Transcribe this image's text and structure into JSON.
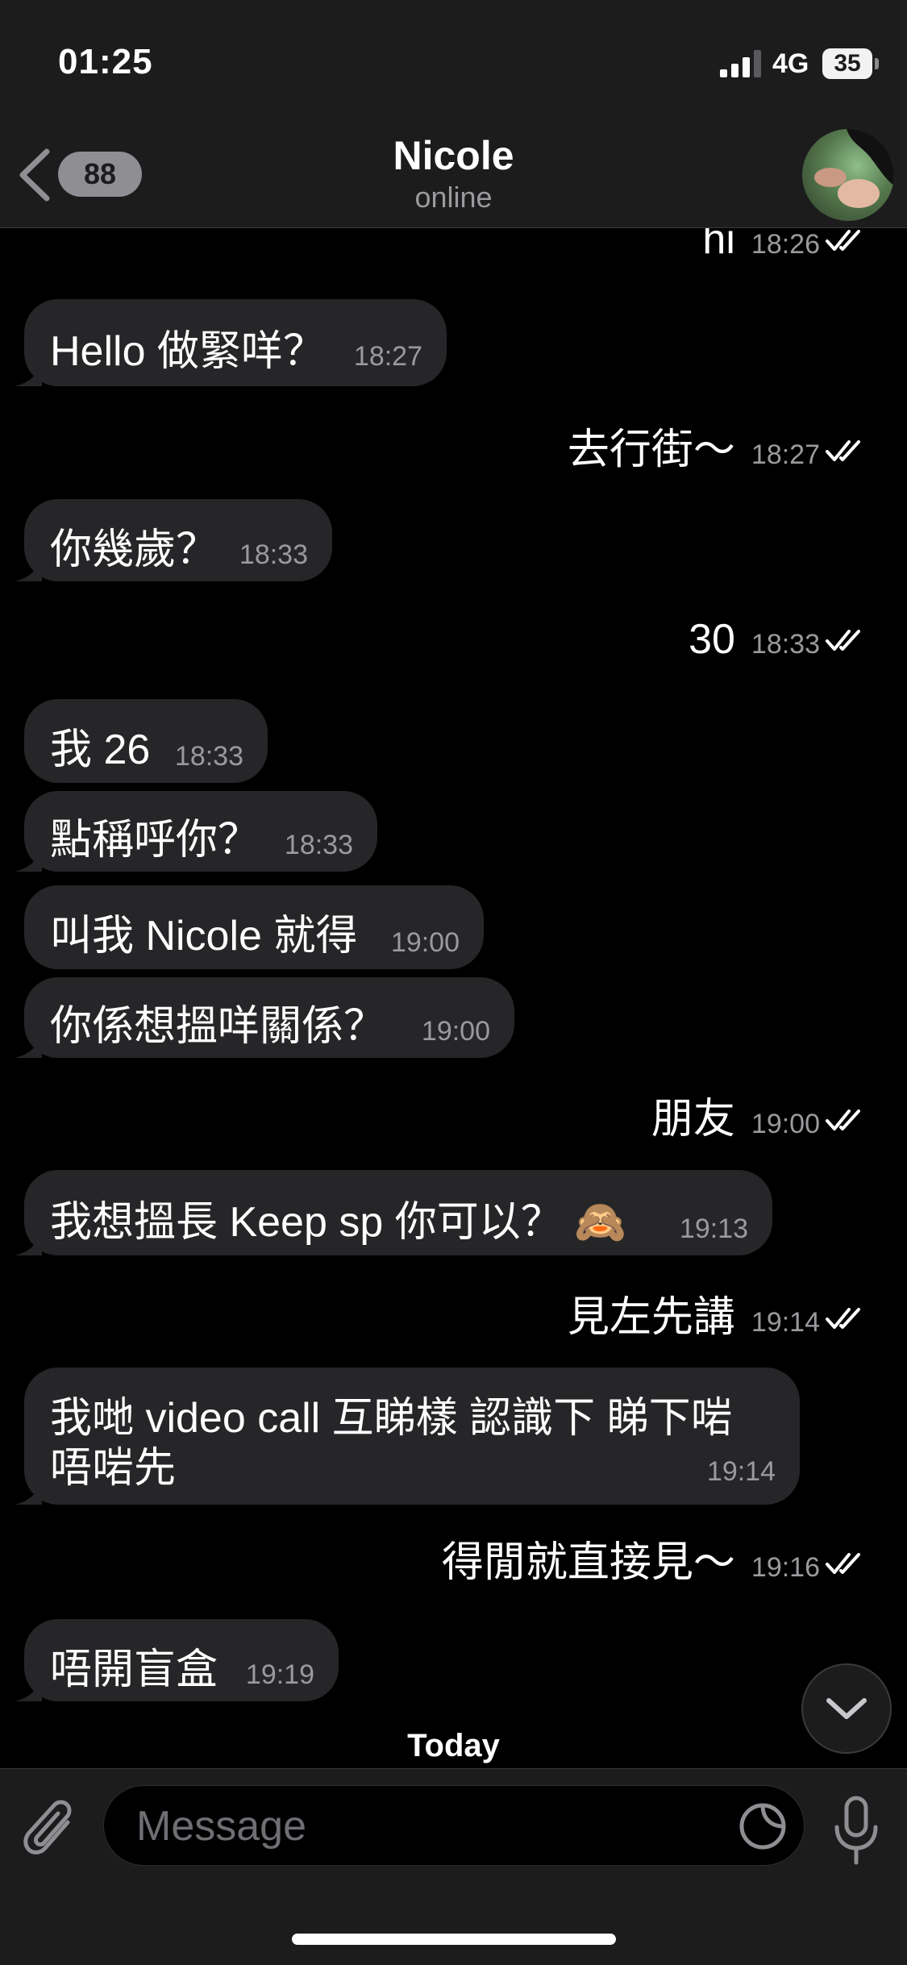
{
  "status_bar": {
    "time": "01:25",
    "network": "4G",
    "battery": "35"
  },
  "header": {
    "back_count": "88",
    "name": "Nicole",
    "status": "online"
  },
  "messages": [
    {
      "dir": "out",
      "text": "hi",
      "time": "18:26"
    },
    {
      "dir": "in",
      "text": "Hello 做緊咩？",
      "time": "18:27"
    },
    {
      "dir": "out",
      "text": "去行街～",
      "time": "18:27"
    },
    {
      "dir": "in",
      "text": "你幾歲？",
      "time": "18:33"
    },
    {
      "dir": "out",
      "text": "30",
      "time": "18:33"
    },
    {
      "dir": "in",
      "text": "我 26",
      "time": "18:33"
    },
    {
      "dir": "in",
      "text": "點稱呼你？",
      "time": "18:33"
    },
    {
      "dir": "in",
      "text": "叫我 Nicole 就得",
      "time": "19:00"
    },
    {
      "dir": "in",
      "text": "你係想搵咩關係？",
      "time": "19:00"
    },
    {
      "dir": "out",
      "text": "朋友",
      "time": "19:00"
    },
    {
      "dir": "in",
      "text": "我想搵長 Keep sp 你可以？ 🙈",
      "time": "19:13"
    },
    {
      "dir": "out",
      "text": "見左先講",
      "time": "19:14"
    },
    {
      "dir": "in",
      "text_line1": "我哋 video call 互睇樣 認識下 睇下啱",
      "text_line2": "唔啱先",
      "time": "19:14"
    },
    {
      "dir": "out",
      "text": "得閒就直接見～",
      "time": "19:16"
    },
    {
      "dir": "in",
      "text": "唔開盲盒",
      "time": "19:19"
    }
  ],
  "date_divider": "Today",
  "input": {
    "placeholder": "Message"
  },
  "icons": {
    "back": "chevron-left-icon",
    "read": "double-check-icon",
    "scroll": "chevron-down-icon",
    "attach": "paperclip-icon",
    "sticker": "sticker-icon",
    "mic": "microphone-icon"
  },
  "colors": {
    "background": "#000000",
    "bar": "#1c1c1d",
    "incoming_bubble": "#262628",
    "timestamp": "#9a9a9e"
  }
}
